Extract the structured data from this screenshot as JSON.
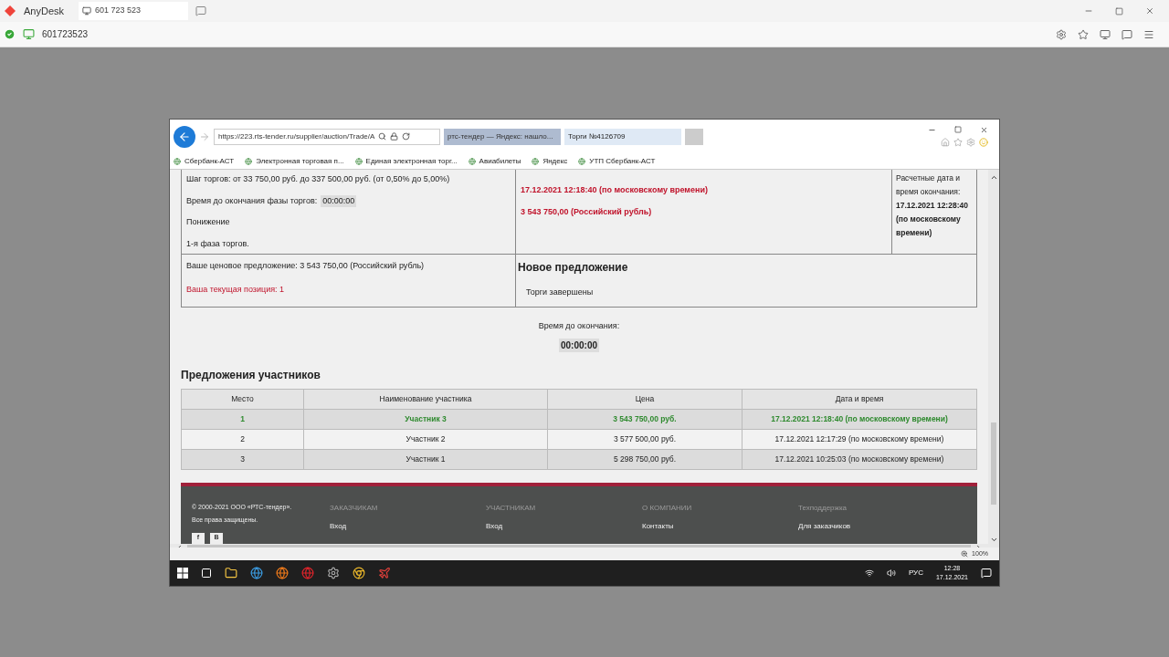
{
  "anydesk": {
    "app_name": "AnyDesk",
    "tab": "601 723 523",
    "address": "601723523"
  },
  "browser": {
    "url": "https://223.rts-tender.ru/supplier/auction/Trade/A",
    "tabs": [
      {
        "title": "ртс-тендер — Яндекс: нашло...",
        "selected": false
      },
      {
        "title": "Торги №4126709",
        "selected": true
      }
    ],
    "favorites": [
      "Сбербанк-АСТ",
      "Электронная торговая п...",
      "Единая электронная торг...",
      "Авиабилеты",
      "Яндекс",
      "УТП Сбербанк-АСТ"
    ],
    "zoom": "100%"
  },
  "auction": {
    "info_lines": [
      "Шаг торгов: от 33 750,00 руб. до 337 500,00 руб. (от 0,50% до 5,00%)",
      "Время до окончания фазы торгов:",
      "Понижение",
      "1-я фаза торгов."
    ],
    "phase_timer": "00:00:00",
    "best_time": "17.12.2021 12:18:40 (по московскому времени)",
    "best_price": "3 543 750,00 (Российский рубль)",
    "end_label": "Расчетные дата и время окончания:",
    "end_value": "17.12.2021 12:28:40 (по московскому времени)",
    "your_offer": "Ваше ценовое предложение: 3 543 750,00 (Российский рубль)",
    "your_position": "Ваша текущая позиция: 1",
    "new_offer_title": "Новое предложение",
    "new_offer_status": "Торги завершены",
    "timer_label": "Время до окончания:",
    "timer": "00:00:00"
  },
  "offers": {
    "title": "Предложения участников",
    "columns": [
      "Место",
      "Наименование участника",
      "Цена",
      "Дата и время"
    ],
    "rows": [
      {
        "cells": [
          "1",
          "Участник 3",
          "3 543 750,00 руб.",
          "17.12.2021 12:18:40 (по московскому времени)"
        ],
        "selected": true
      },
      {
        "cells": [
          "2",
          "Участник 2",
          "3 577 500,00 руб.",
          "17.12.2021 12:17:29 (по московскому времени)"
        ],
        "selected": false
      },
      {
        "cells": [
          "3",
          "Участник 1",
          "5 298 750,00 руб.",
          "17.12.2021 10:25:03 (по московскому времени)"
        ],
        "selected": false
      }
    ]
  },
  "footer": {
    "copyright": [
      "© 2000-2021 ООО «РТС-тендер».",
      "Все права защищены."
    ],
    "socials": [
      "f",
      "В"
    ],
    "columns": [
      {
        "heading": "ЗАКАЗЧИКАМ",
        "links": [
          "Вход"
        ]
      },
      {
        "heading": "УЧАСТНИКАМ",
        "links": [
          "Вход"
        ]
      },
      {
        "heading": "О КОМПАНИИ",
        "links": [
          "Контакты"
        ]
      },
      {
        "heading": "Техподдержка",
        "links": [
          "Для заказчиков"
        ]
      }
    ]
  },
  "taskbar": {
    "language": "РУС",
    "time": "12:28",
    "date": "17.12.2021"
  }
}
